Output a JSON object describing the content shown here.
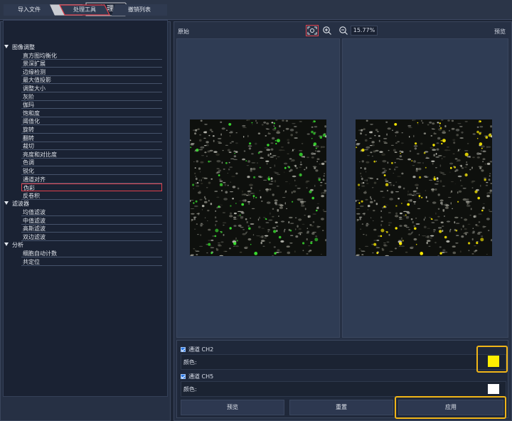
{
  "toolbar": {
    "combo_value": "",
    "breadcrumb": "处理"
  },
  "tabs": [
    {
      "label": "导入文件"
    },
    {
      "label": "处理工具",
      "active": true
    },
    {
      "label": "撤销列表"
    }
  ],
  "tree": {
    "cat1": "图像调整",
    "cat1_items": [
      "直方图均衡化",
      "景深扩展",
      "边缘检测",
      "最大值投影",
      "调整大小",
      "灰阶",
      "伽玛",
      "饱和度",
      "阈值化",
      "旋转",
      "翻转",
      "裁切",
      "亮度和对比度",
      "色调",
      "锐化",
      "通道对齐",
      "伪彩",
      "反卷积"
    ],
    "selected": "伪彩",
    "cat2": "滤波器",
    "cat2_items": [
      "均值滤波",
      "中值滤波",
      "高斯滤波",
      "双边滤波"
    ],
    "cat3": "分析",
    "cat3_items": [
      "细胞自动计数",
      "共定位"
    ]
  },
  "viewer": {
    "left_label": "原始",
    "right_label": "预览",
    "zoom": "15.77%",
    "fit_icon": "fit-screen-icon",
    "zoom_in_icon": "zoom-in-icon",
    "zoom_out_icon": "zoom-out-icon"
  },
  "channels": [
    {
      "name": "通道 CH2",
      "color_label": "颜色:",
      "checked": true,
      "color": "#ffee00"
    },
    {
      "name": "通道 CH5",
      "color_label": "颜色:",
      "checked": true,
      "color": "#ffffff"
    }
  ],
  "buttons": {
    "preview": "预览",
    "reset": "重置",
    "apply": "应用"
  },
  "colors": {
    "accent_red": "#e0404c",
    "highlight_yellow": "#f0b518"
  }
}
